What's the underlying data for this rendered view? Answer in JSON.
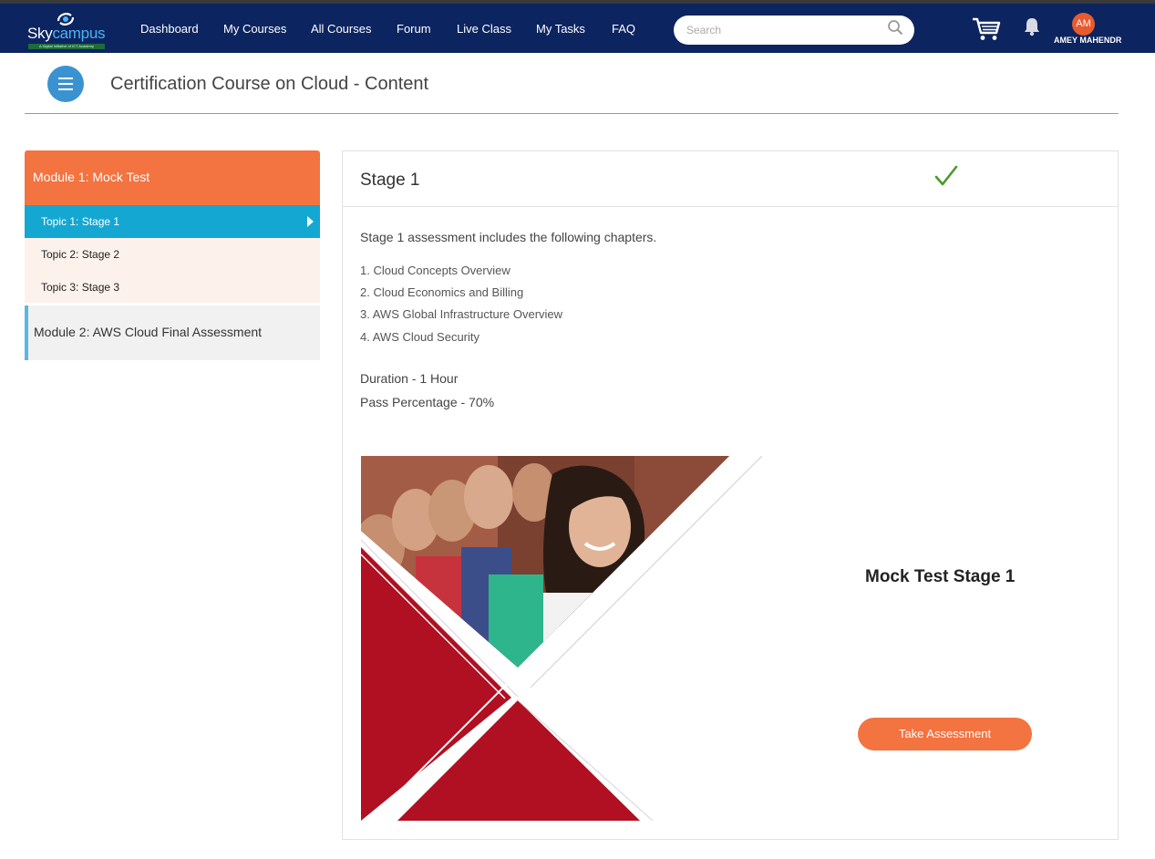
{
  "brand": {
    "name_part1": "Sky",
    "name_part2": "campus",
    "tagline": "A Digital Initiative of ICT Academy",
    "icon": "skycampus-logo-icon"
  },
  "nav": {
    "items": [
      {
        "label": "Dashboard"
      },
      {
        "label": "My Courses"
      },
      {
        "label": "All Courses"
      },
      {
        "label": "Forum"
      },
      {
        "label": "Live Class"
      },
      {
        "label": "My Tasks"
      },
      {
        "label": "FAQ"
      }
    ],
    "search_placeholder": "Search",
    "search_icon": "search-icon",
    "cart_icon": "cart-icon",
    "bell_icon": "bell-icon",
    "user": {
      "initials": "AM",
      "name": "AMEY MAHENDR"
    }
  },
  "page": {
    "title": "Certification Course on Cloud - Content",
    "menu_icon": "hamburger-icon"
  },
  "sidebar": {
    "module1": {
      "label": "Module 1: Mock Test",
      "topics": [
        {
          "label": "Topic 1: Stage 1",
          "active": true
        },
        {
          "label": "Topic 2: Stage 2",
          "active": false
        },
        {
          "label": "Topic 3: Stage 3",
          "active": false
        }
      ]
    },
    "module2": {
      "label": "Module 2: AWS Cloud Final Assessment"
    }
  },
  "content": {
    "stage_title": "Stage 1",
    "status_icon": "checkmark-icon",
    "intro": "Stage 1 assessment includes the following chapters.",
    "chapters": [
      "1. Cloud Concepts Overview",
      "2. Cloud Economics and Billing",
      "3. AWS Global Infrastructure Overview",
      "4. AWS Cloud Security"
    ],
    "duration": "Duration - 1 Hour",
    "pass_percentage": "Pass Percentage - 70%",
    "mock_title": "Mock Test Stage 1",
    "button_label": "Take Assessment"
  },
  "colors": {
    "navbar": "#0c2460",
    "accent_orange": "#f37341",
    "active_topic": "#14a7d1",
    "promo_red": "#b01021"
  }
}
